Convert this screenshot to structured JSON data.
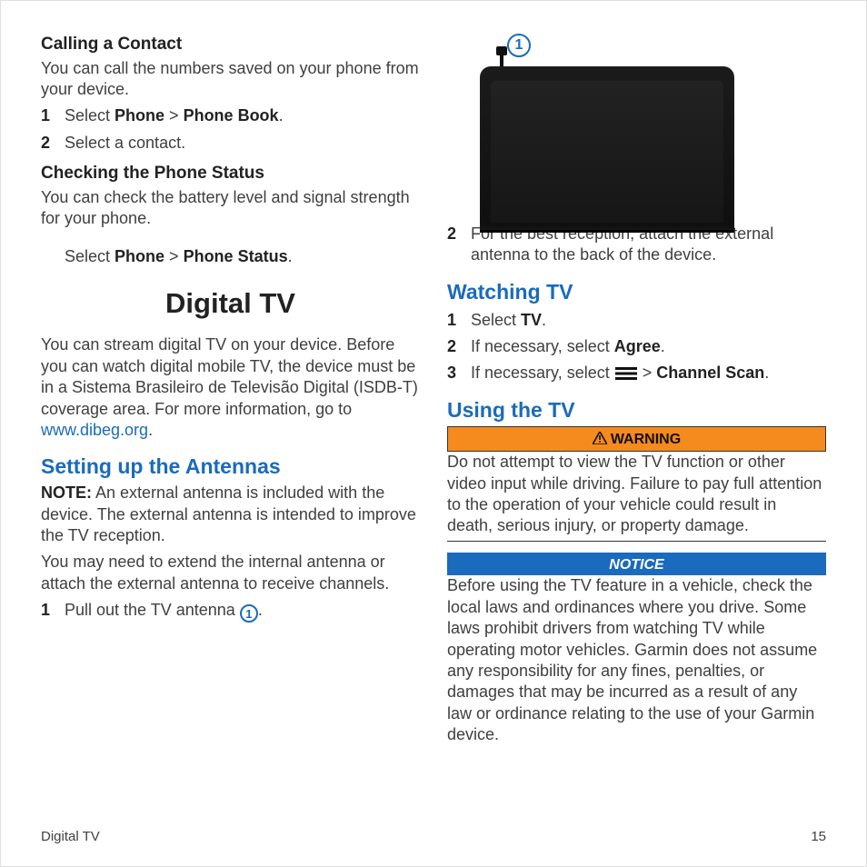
{
  "left": {
    "sec1": {
      "title": "Calling a Contact",
      "lead": "You can call the numbers saved on your phone from your device.",
      "steps": [
        {
          "n": "1",
          "pre": "Select ",
          "b1": "Phone",
          "sep": " > ",
          "b2": "Phone Book",
          "post": "."
        },
        {
          "n": "2",
          "plain": "Select a contact."
        }
      ]
    },
    "sec2": {
      "title": "Checking the Phone Status",
      "lead": "You can check the battery level and signal strength for your phone.",
      "indent": {
        "pre": "Select ",
        "b1": "Phone",
        "sep": " > ",
        "b2": "Phone Status",
        "post": "."
      }
    },
    "digitalTv": {
      "title": "Digital TV",
      "para_pre": "You can stream digital TV on your device. Before you can watch digital mobile TV, the device must be in a Sistema Brasileiro de Televisão Digital (ISDB-T) coverage area. For more information, go to ",
      "link": "www.dibeg.org",
      "para_post": "."
    },
    "antennas": {
      "title": "Setting up the Antennas",
      "note_label": "NOTE:",
      "note_body": " An external antenna is included with the device. The external antenna is intended to improve the TV reception.",
      "p2": "You may need to extend the internal antenna or attach the external antenna to receive channels.",
      "step1": {
        "n": "1",
        "pre": "Pull out the TV antenna ",
        "badge": "1",
        "post": "."
      }
    }
  },
  "right": {
    "calloutBadge": "1",
    "step2": {
      "n": "2",
      "text": "For the best reception, attach the external antenna to the back of the device."
    },
    "watching": {
      "title": "Watching TV",
      "steps": [
        {
          "n": "1",
          "pre": "Select ",
          "b1": "TV",
          "post": "."
        },
        {
          "n": "2",
          "pre": "If necessary, select ",
          "b1": "Agree",
          "post": "."
        },
        {
          "n": "3",
          "pre": "If necessary, select ",
          "icon": true,
          "mid": " > ",
          "b1": "Channel Scan",
          "post": "."
        }
      ]
    },
    "using": {
      "title": "Using the TV",
      "warning_label": "WARNING",
      "warning_body": "Do not attempt to view the TV function or other video input while driving. Failure to pay full attention to the operation of your vehicle could result in death, serious injury, or property damage.",
      "notice_label": "NOTICE",
      "notice_body": "Before using the TV feature in a vehicle, check the local laws and ordinances where you drive. Some laws prohibit drivers from watching TV while operating motor vehicles. Garmin does not assume any responsibility for any fines, penalties, or damages that may be incurred as a result of any law or ordinance relating to the use of your Garmin device."
    }
  },
  "footer": {
    "section": "Digital TV",
    "page": "15"
  }
}
